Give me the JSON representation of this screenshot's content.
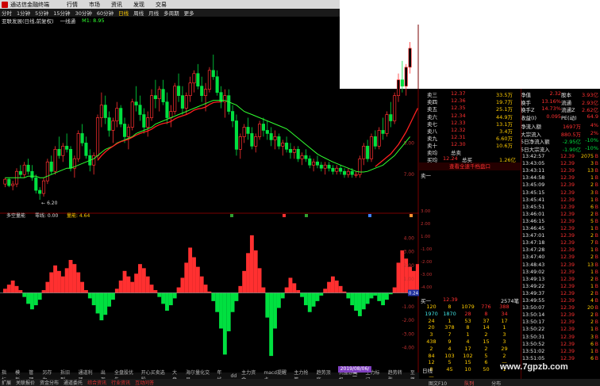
{
  "titlebar": {
    "title": "通达信金融终端",
    "menu": [
      "行情",
      "市场",
      "资讯",
      "发现",
      "交易"
    ]
  },
  "periods": {
    "items": [
      "分时",
      "1分钟",
      "5分钟",
      "15分钟",
      "30分钟",
      "60分钟",
      "日线",
      "周线",
      "月线",
      "多周期",
      "更多"
    ],
    "selected": "日线"
  },
  "info": {
    "stock": "亚联发展(日线,前复权)",
    "indicator": "一线通",
    "m1": "M1: 8.95"
  },
  "chart_data": [
    {
      "type": "candlestick",
      "title": "",
      "low_label": "6.20",
      "ticks": [
        "7.00",
        "8.00"
      ],
      "ylim": [
        5.8,
        11.5
      ],
      "candles": [
        [
          6.7,
          6.9,
          6.6,
          6.85
        ],
        [
          6.85,
          6.9,
          6.6,
          6.65
        ],
        [
          6.65,
          6.8,
          6.5,
          6.7
        ],
        [
          6.7,
          7.2,
          6.6,
          7.1
        ],
        [
          7.1,
          7.3,
          6.9,
          7.0
        ],
        [
          7.0,
          7.4,
          6.9,
          7.3
        ],
        [
          7.3,
          7.5,
          7.0,
          7.1
        ],
        [
          7.1,
          7.3,
          6.8,
          6.9
        ],
        [
          6.9,
          7.0,
          6.4,
          6.5
        ],
        [
          6.5,
          6.6,
          6.2,
          6.4
        ],
        [
          6.4,
          6.9,
          6.3,
          6.8
        ],
        [
          6.8,
          7.5,
          6.7,
          7.4
        ],
        [
          7.4,
          7.6,
          7.0,
          7.1
        ],
        [
          7.1,
          7.9,
          7.0,
          7.8
        ],
        [
          7.8,
          8.2,
          7.5,
          7.6
        ],
        [
          7.6,
          8.0,
          7.4,
          7.9
        ],
        [
          7.9,
          8.3,
          7.7,
          7.8
        ],
        [
          7.8,
          7.9,
          7.1,
          7.2
        ],
        [
          7.2,
          7.6,
          6.9,
          7.5
        ],
        [
          7.5,
          8.4,
          7.4,
          8.3
        ],
        [
          8.3,
          8.6,
          7.9,
          8.0
        ],
        [
          8.0,
          8.2,
          7.5,
          7.6
        ],
        [
          7.6,
          7.8,
          7.1,
          7.3
        ],
        [
          7.3,
          7.7,
          7.0,
          7.6
        ],
        [
          7.6,
          8.9,
          7.5,
          8.8
        ],
        [
          8.8,
          9.6,
          8.5,
          9.2
        ],
        [
          9.2,
          9.5,
          8.6,
          8.8
        ],
        [
          8.8,
          9.0,
          8.2,
          8.4
        ],
        [
          8.4,
          8.8,
          8.0,
          8.7
        ],
        [
          8.7,
          9.3,
          8.5,
          9.1
        ],
        [
          9.1,
          9.2,
          8.5,
          8.6
        ],
        [
          8.6,
          8.8,
          8.0,
          8.2
        ],
        [
          8.2,
          8.6,
          7.8,
          8.5
        ],
        [
          8.5,
          9.4,
          8.4,
          9.3
        ],
        [
          9.3,
          9.8,
          9.0,
          9.2
        ],
        [
          9.2,
          9.5,
          8.7,
          8.9
        ],
        [
          8.9,
          9.1,
          8.3,
          8.5
        ],
        [
          8.5,
          9.0,
          8.2,
          8.8
        ],
        [
          8.8,
          9.7,
          8.7,
          9.5
        ],
        [
          9.5,
          10.0,
          9.1,
          9.4
        ],
        [
          9.4,
          9.8,
          9.0,
          9.7
        ],
        [
          9.7,
          10.0,
          9.2,
          9.3
        ],
        [
          9.3,
          9.6,
          8.6,
          8.8
        ],
        [
          8.8,
          9.2,
          8.5,
          9.0
        ],
        [
          9.0,
          9.9,
          8.9,
          9.8
        ],
        [
          9.8,
          10.2,
          9.3,
          9.5
        ],
        [
          9.5,
          9.8,
          8.9,
          9.1
        ],
        [
          9.1,
          9.6,
          8.9,
          9.5
        ],
        [
          9.5,
          10.1,
          9.3,
          9.9
        ],
        [
          9.9,
          10.3,
          9.6,
          10.2
        ],
        [
          10.2,
          10.5,
          9.7,
          9.8
        ],
        [
          9.8,
          10.1,
          9.3,
          9.5
        ],
        [
          9.5,
          9.9,
          9.0,
          9.7
        ],
        [
          9.7,
          10.4,
          9.6,
          10.3
        ],
        [
          10.3,
          10.8,
          10.0,
          10.1
        ],
        [
          10.1,
          10.3,
          9.5,
          9.6
        ],
        [
          9.6,
          9.8,
          9.1,
          9.3
        ],
        [
          9.3,
          9.7,
          8.8,
          9.5
        ],
        [
          9.5,
          9.7,
          8.9,
          9.0
        ],
        [
          9.0,
          9.2,
          8.5,
          8.7
        ],
        [
          8.7,
          8.9,
          7.6,
          7.8
        ],
        [
          7.8,
          8.3,
          7.5,
          8.2
        ],
        [
          8.2,
          8.6,
          8.0,
          8.5
        ],
        [
          8.5,
          8.8,
          8.1,
          8.3
        ],
        [
          8.3,
          8.5,
          7.8,
          7.9
        ],
        [
          7.9,
          8.3,
          7.7,
          8.2
        ],
        [
          8.2,
          8.7,
          8.1,
          8.6
        ],
        [
          8.6,
          8.8,
          8.2,
          8.4
        ],
        [
          8.4,
          8.7,
          8.1,
          8.3
        ],
        [
          8.3,
          8.5,
          7.9,
          8.1
        ],
        [
          8.1,
          8.4,
          7.8,
          8.2
        ],
        [
          8.2,
          8.3,
          7.8,
          7.9
        ],
        [
          7.9,
          8.1,
          7.6,
          8.0
        ],
        [
          8.0,
          8.2,
          7.7,
          7.8
        ],
        [
          7.8,
          8.0,
          7.5,
          7.7
        ],
        [
          7.7,
          7.9,
          7.5,
          7.8
        ],
        [
          7.8,
          7.9,
          7.4,
          7.5
        ],
        [
          7.5,
          7.7,
          7.3,
          7.6
        ],
        [
          7.6,
          7.8,
          7.4,
          7.5
        ],
        [
          7.5,
          7.6,
          7.2,
          7.3
        ],
        [
          7.3,
          7.5,
          7.1,
          7.4
        ],
        [
          7.4,
          7.6,
          7.2,
          7.3
        ],
        [
          7.3,
          7.4,
          7.1,
          7.2
        ],
        [
          7.2,
          7.4,
          7.0,
          7.3
        ],
        [
          7.3,
          7.4,
          7.1,
          7.2
        ],
        [
          7.2,
          7.3,
          7.0,
          7.1
        ],
        [
          7.1,
          7.3,
          7.0,
          7.2
        ],
        [
          7.2,
          7.3,
          7.0,
          7.1
        ],
        [
          7.1,
          7.2,
          6.9,
          7.0
        ],
        [
          7.0,
          7.2,
          6.9,
          7.1
        ],
        [
          7.1,
          7.2,
          6.9,
          7.0
        ],
        [
          7.0,
          7.1,
          6.9,
          7.0
        ],
        [
          7.0,
          7.6,
          6.9,
          7.5
        ],
        [
          7.5,
          8.0,
          7.3,
          7.9
        ],
        [
          7.9,
          8.1,
          7.4,
          7.5
        ],
        [
          7.5,
          8.3,
          7.4,
          8.2
        ],
        [
          8.2,
          8.4,
          7.8,
          7.9
        ],
        [
          7.9,
          8.5,
          7.8,
          8.4
        ],
        [
          8.4,
          8.8,
          8.1,
          8.3
        ],
        [
          8.3,
          9.0,
          8.2,
          8.9
        ],
        [
          8.9,
          9.3,
          8.5,
          8.7
        ],
        [
          8.7,
          9.6,
          8.6,
          9.5
        ],
        [
          9.5,
          10.2,
          9.3,
          10.0
        ],
        [
          10.0,
          10.6,
          9.6,
          9.8
        ],
        [
          9.8,
          10.5,
          9.5,
          10.4
        ],
        [
          10.4,
          11.2,
          10.2,
          11.0
        ]
      ],
      "ma": [
        6.9,
        6.9,
        6.9,
        6.9,
        6.9,
        6.9,
        6.95,
        6.95,
        6.95,
        6.9,
        6.9,
        6.95,
        7.0,
        7.05,
        7.1,
        7.15,
        7.2,
        7.2,
        7.25,
        7.3,
        7.35,
        7.4,
        7.45,
        7.5,
        7.6,
        7.7,
        7.8,
        7.85,
        7.9,
        8.0,
        8.05,
        8.1,
        8.15,
        8.2,
        8.3,
        8.35,
        8.4,
        8.45,
        8.5,
        8.6,
        8.65,
        8.7,
        8.75,
        8.8,
        8.85,
        8.9,
        8.95,
        9.0,
        9.05,
        9.1,
        9.15,
        9.2,
        9.25,
        9.3,
        9.35,
        9.35,
        9.35,
        9.35,
        9.3,
        9.25,
        9.2,
        9.1,
        9.0,
        8.95,
        8.9,
        8.85,
        8.8,
        8.75,
        8.7,
        8.65,
        8.6,
        8.55,
        8.5,
        8.45,
        8.35,
        8.25,
        8.15,
        8.05,
        7.95,
        7.85,
        7.75,
        7.65,
        7.58,
        7.52,
        7.46,
        7.4,
        7.35,
        7.3,
        7.25,
        7.2,
        7.15,
        7.1,
        7.08,
        7.08,
        7.1,
        7.15,
        7.2,
        7.25,
        7.3,
        7.4,
        7.5,
        7.6,
        7.75,
        7.9,
        8.05,
        8.2
      ],
      "support": [
        null,
        null,
        null,
        null,
        null,
        null,
        null,
        null,
        null,
        null,
        null,
        null,
        null,
        null,
        null,
        null,
        null,
        null,
        null,
        null,
        null,
        null,
        null,
        null,
        7.45,
        7.6,
        7.72,
        7.82,
        7.9,
        7.98,
        8.04,
        8.08,
        8.12,
        8.18,
        8.25,
        8.3,
        8.34,
        8.38,
        8.44,
        8.52,
        8.58,
        8.62,
        8.64,
        8.68,
        8.76,
        8.82,
        8.86,
        8.9,
        8.96,
        9.04,
        9.08,
        9.1,
        9.14,
        9.22,
        9.28,
        9.3,
        9.3,
        null,
        null,
        null,
        null,
        null,
        null,
        null,
        null,
        null,
        null,
        null,
        null,
        null,
        null,
        null,
        null,
        null,
        null,
        null,
        null,
        null,
        null,
        null,
        null,
        null,
        null,
        null,
        null,
        null,
        null,
        null,
        null,
        null,
        null,
        null,
        null,
        null,
        null,
        null,
        7.25,
        7.35,
        7.45,
        7.55,
        7.65,
        7.8,
        7.95,
        8.15,
        8.35,
        8.6,
        8.85,
        9.1
      ]
    },
    {
      "type": "bar",
      "title": "多空量能",
      "zero_label": "零线: 0.00",
      "value_label": "量能: 4.64",
      "current_value": "0.24",
      "ticks": [
        "4.00",
        "3.00",
        "2.00",
        "1.00",
        "-1.00",
        "-2.00",
        "-3.00",
        "-4.00"
      ],
      "ylim": [
        -5,
        5
      ],
      "values": [
        0.3,
        0.6,
        0.9,
        0.5,
        0.2,
        -0.3,
        -0.8,
        -1.2,
        -0.9,
        -0.5,
        0.2,
        0.8,
        1.5,
        2.0,
        1.6,
        1.2,
        1.8,
        2.4,
        2.1,
        1.5,
        0.8,
        0.2,
        -0.4,
        -0.9,
        -1.5,
        -2.0,
        -1.6,
        -1.0,
        -0.5,
        0.3,
        0.9,
        1.6,
        1.2,
        0.8,
        1.4,
        2.1,
        1.8,
        1.2,
        0.6,
        0.2,
        -0.3,
        -0.8,
        -1.3,
        -0.9,
        -0.4,
        0.4,
        1.1,
        2.2,
        3.3,
        2.6,
        1.9,
        1.2,
        0.6,
        0.1,
        -0.6,
        -1.4,
        -2.6,
        -4.5,
        -2.8,
        -1.4,
        -0.6,
        0.5,
        1.6,
        2.9,
        4.2,
        3.1,
        1.8,
        0.4,
        -1.8,
        -4.6,
        -2.6,
        -1.1,
        -0.4,
        0.4,
        1.1,
        0.7,
        0.2,
        -0.3,
        -0.9,
        -1.4,
        -1.0,
        -0.6,
        -0.2,
        0.3,
        0.8,
        1.2,
        0.9,
        0.5,
        0.1,
        -0.4,
        -0.9,
        -1.3,
        -1.7,
        -1.2,
        -0.8,
        -0.4,
        -0.2,
        -0.6,
        -0.9,
        -0.5,
        -0.1,
        0.4,
        2.2,
        3.1,
        2.5,
        1.9,
        1.6,
        2.1,
        1.5,
        2.0,
        2.7,
        4.6
      ]
    }
  ],
  "orderbook": {
    "asks": [
      {
        "name": "卖十",
        "price": "12.30",
        "vol": "10.6万"
      },
      {
        "name": "卖九",
        "price": "12.31",
        "vol": "6.60万"
      },
      {
        "name": "卖八",
        "price": "12.32",
        "vol": "3.4万"
      },
      {
        "name": "卖七",
        "price": "12.33",
        "vol": "13.1万"
      },
      {
        "name": "卖六",
        "price": "12.34",
        "vol": "44.9万"
      },
      {
        "name": "卖五",
        "price": "12.35",
        "vol": "25.1万"
      },
      {
        "name": "卖四",
        "price": "12.36",
        "vol": "19.7万"
      },
      {
        "name": "卖三",
        "price": "12.37",
        "vol": "33.5万"
      }
    ],
    "total_sell_label": "总卖",
    "total_buy_label": "总买",
    "buy_avg_label": "买均",
    "buy_avg_value": "12.24",
    "sell_avg_label": "卖均",
    "total_buy_value": "1.26亿",
    "detail_link": "查看全速千档盘口",
    "queue_label": "卖一",
    "buy1_label": "买一",
    "buy1_price": "12.39",
    "buy1_vol": "2574笔",
    "queue_rows": [
      [
        "120",
        "8",
        "1079",
        "776",
        "388"
      ],
      [
        "1970",
        "1870",
        "28",
        "8",
        "34"
      ],
      [
        "24",
        "1",
        "53",
        "37",
        "17"
      ],
      [
        "20",
        "378",
        "8",
        "14",
        "1"
      ],
      [
        "3",
        "7",
        "1",
        "2",
        "3"
      ],
      [
        "438",
        "9",
        "4",
        "15",
        "3"
      ],
      [
        "2",
        "4",
        "17",
        "2",
        "29"
      ],
      [
        "84",
        "103",
        "102",
        "5",
        "2"
      ],
      [
        "12",
        "5",
        "15",
        "6",
        "—"
      ],
      [
        "8",
        "45",
        "10",
        "50",
        "1"
      ],
      [
        "—",
        "",
        "",
        "",
        ""
      ]
    ],
    "queue_axis": [
      "3.00",
      "2.00",
      "1.00",
      "-1.00",
      "-2.00",
      "-3.00",
      "-4.00"
    ]
  },
  "finance": [
    {
      "k": "净值",
      "v1": "2.32",
      "k2": "股本",
      "v2": "3.93亿"
    },
    {
      "k": "换手",
      "v1": "13.16%",
      "k2": "流通",
      "v2": "2.93亿"
    },
    {
      "k": "换手Z",
      "v1": "14.73%",
      "k2": "流通Z",
      "v2": "2.62亿"
    },
    {
      "k": "收益(I)",
      "v1": "0.095",
      "k2": "PE(动)",
      "v2": "64.9"
    }
  ],
  "flows": [
    {
      "k": "净流入额",
      "v": "1697万",
      "p": "4%"
    },
    {
      "k": "大宗流入",
      "v": "880.5万",
      "p": "2%"
    },
    {
      "k": "5日净流入额",
      "v": "-2.95亿",
      "p": "-10%"
    },
    {
      "k": "5日大宗流入",
      "v": "-1.90亿",
      "p": "-10%"
    }
  ],
  "ticks": [
    {
      "t": "13:42:57",
      "p": "12.39",
      "v": "2075"
    },
    {
      "t": "13:43:05",
      "p": "12.39",
      "v": "3"
    },
    {
      "t": "13:43:11",
      "p": "12.39",
      "v": "13"
    },
    {
      "t": "13:44:58",
      "p": "12.39",
      "v": "1"
    },
    {
      "t": "13:45:09",
      "p": "12.39",
      "v": "2"
    },
    {
      "t": "13:45:15",
      "p": "12.39",
      "v": "3"
    },
    {
      "t": "13:45:41",
      "p": "12.39",
      "v": "1"
    },
    {
      "t": "13:45:51",
      "p": "12.39",
      "v": "6"
    },
    {
      "t": "13:46:01",
      "p": "12.39",
      "v": "2"
    },
    {
      "t": "13:46:15",
      "p": "12.39",
      "v": "5"
    },
    {
      "t": "13:46:45",
      "p": "12.39",
      "v": "1"
    },
    {
      "t": "13:47:01",
      "p": "12.39",
      "v": "2"
    },
    {
      "t": "13:47:18",
      "p": "12.39",
      "v": "7"
    },
    {
      "t": "13:47:28",
      "p": "12.39",
      "v": "1"
    },
    {
      "t": "13:47:40",
      "p": "12.39",
      "v": "2"
    },
    {
      "t": "13:48:43",
      "p": "12.39",
      "v": "13"
    },
    {
      "t": "13:49:02",
      "p": "12.39",
      "v": "1"
    },
    {
      "t": "13:49:13",
      "p": "12.39",
      "v": "2"
    },
    {
      "t": "13:49:22",
      "p": "12.39",
      "v": "1"
    },
    {
      "t": "13:49:37",
      "p": "12.39",
      "v": "2"
    },
    {
      "t": "13:49:55",
      "p": "12.39",
      "v": "4"
    },
    {
      "t": "13:50:07",
      "p": "12.39",
      "v": "20"
    },
    {
      "t": "13:50:14",
      "p": "12.39",
      "v": "2"
    },
    {
      "t": "13:50:17",
      "p": "12.39",
      "v": "2"
    },
    {
      "t": "13:50:22",
      "p": "12.39",
      "v": "1"
    },
    {
      "t": "13:50:31",
      "p": "12.39",
      "v": "3"
    },
    {
      "t": "13:50:52",
      "p": "12.39",
      "v": "6"
    },
    {
      "t": "13:51:02",
      "p": "12.39",
      "v": "1"
    },
    {
      "t": "13:51:05",
      "p": "12.39",
      "v": "6"
    }
  ],
  "bottom": {
    "date_label": "2019/08/06/二",
    "period_label": "日线",
    "tabs1": [
      "指标",
      "模板",
      "管理",
      "另存为",
      "拆旧到",
      "通道利器",
      "出现",
      "全盘股优先",
      "开心买卖选股",
      "大盘",
      "海尔量化交易",
      "年线",
      "dd",
      "主力资金",
      "macd提醒点",
      "主力抢筹",
      "趋势顶底",
      "洗盘游离机",
      "主力标记",
      "趋势转型",
      "至尊"
    ],
    "tabs2": [
      "扩展",
      "关联报价",
      "资金分布",
      "通道委托",
      "综合资讯",
      "行业资讯",
      "互动问答"
    ],
    "right_tabs": [
      "图文F10",
      "队列",
      "分布"
    ]
  },
  "watermark": "www.7gpzb.com",
  "colors": {
    "up": "#ff3030",
    "down": "#00e040",
    "ma": "#30ff30",
    "support": "#ff2020",
    "label": "#ffcc00"
  }
}
